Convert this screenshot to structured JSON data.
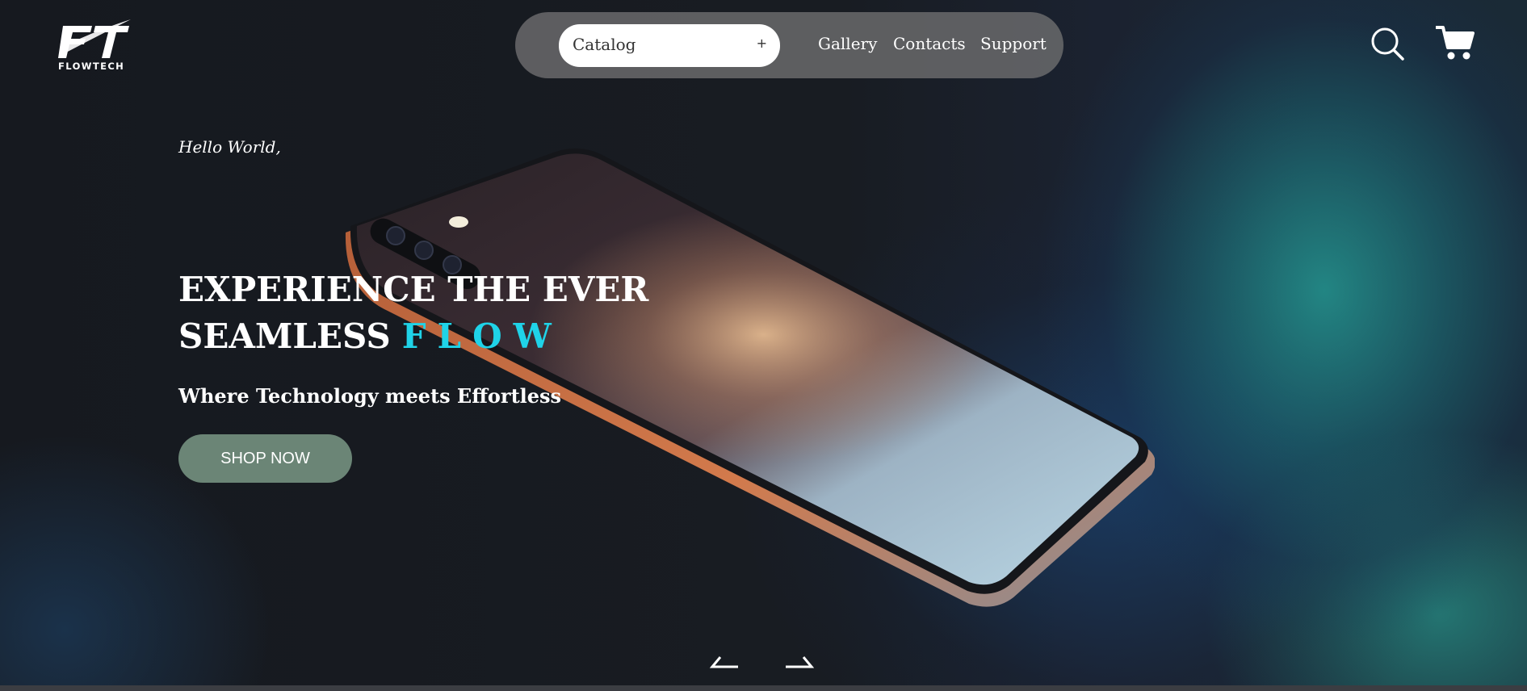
{
  "brand": {
    "logo_text": "FLOWTECH"
  },
  "nav": {
    "catalog_label": "Catalog",
    "catalog_toggle": "+",
    "links": [
      {
        "label": "Gallery"
      },
      {
        "label": "Contacts"
      },
      {
        "label": "Support"
      }
    ]
  },
  "header_icons": {
    "search": "search-icon",
    "cart": "cart-icon"
  },
  "hero": {
    "greeting": "Hello World,",
    "headline_line1": "EXPERIENCE THE EVER",
    "headline_line2": "SEAMLESS",
    "headline_accent": "FLOW",
    "tagline": "Where Technology meets Effortless",
    "cta_label": "SHOP NOW"
  },
  "carousel": {
    "prev_icon": "arrow-left-icon",
    "next_icon": "arrow-right-icon"
  },
  "colors": {
    "accent": "#1fd3e8",
    "cta_background": "#6b8576",
    "background": "#16191f",
    "nav_pill": "#6c6c6e",
    "glow_teal": "#249691"
  }
}
